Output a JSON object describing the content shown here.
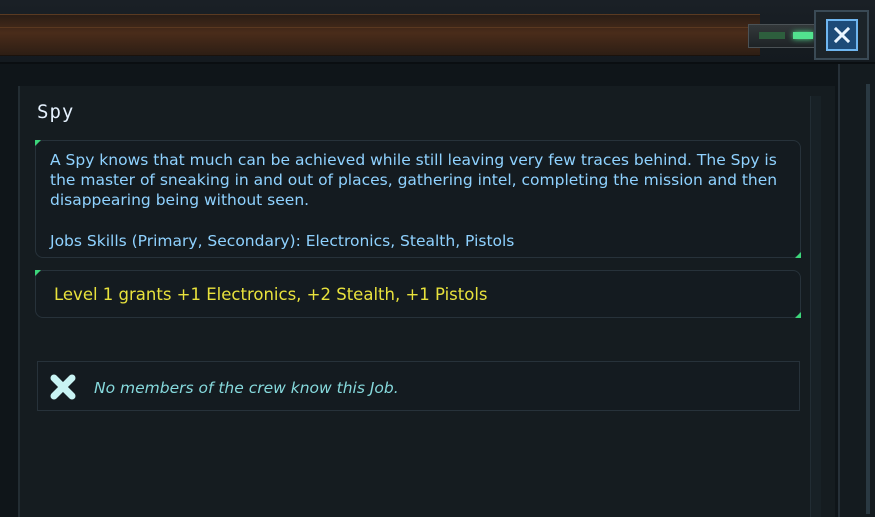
{
  "window": {
    "close_icon": "close-icon",
    "accent_color": "#6fb6ef"
  },
  "job": {
    "title": "Spy",
    "description": "A Spy knows that much can be achieved while still leaving very few traces behind. The Spy is the master of sneaking in and out of places, gathering intel, completing the mission and then disappearing being without seen.",
    "skills": "Jobs Skills (Primary, Secondary): Electronics, Stealth, Pistols",
    "grant": "Level 1 grants +1 Electronics, +2 Stealth, +1 Pistols",
    "text_color": "#8fd2ff",
    "grant_color": "#e8e23c"
  },
  "crew": {
    "status_icon": "x-icon",
    "message": "No members of the crew know this Job."
  }
}
